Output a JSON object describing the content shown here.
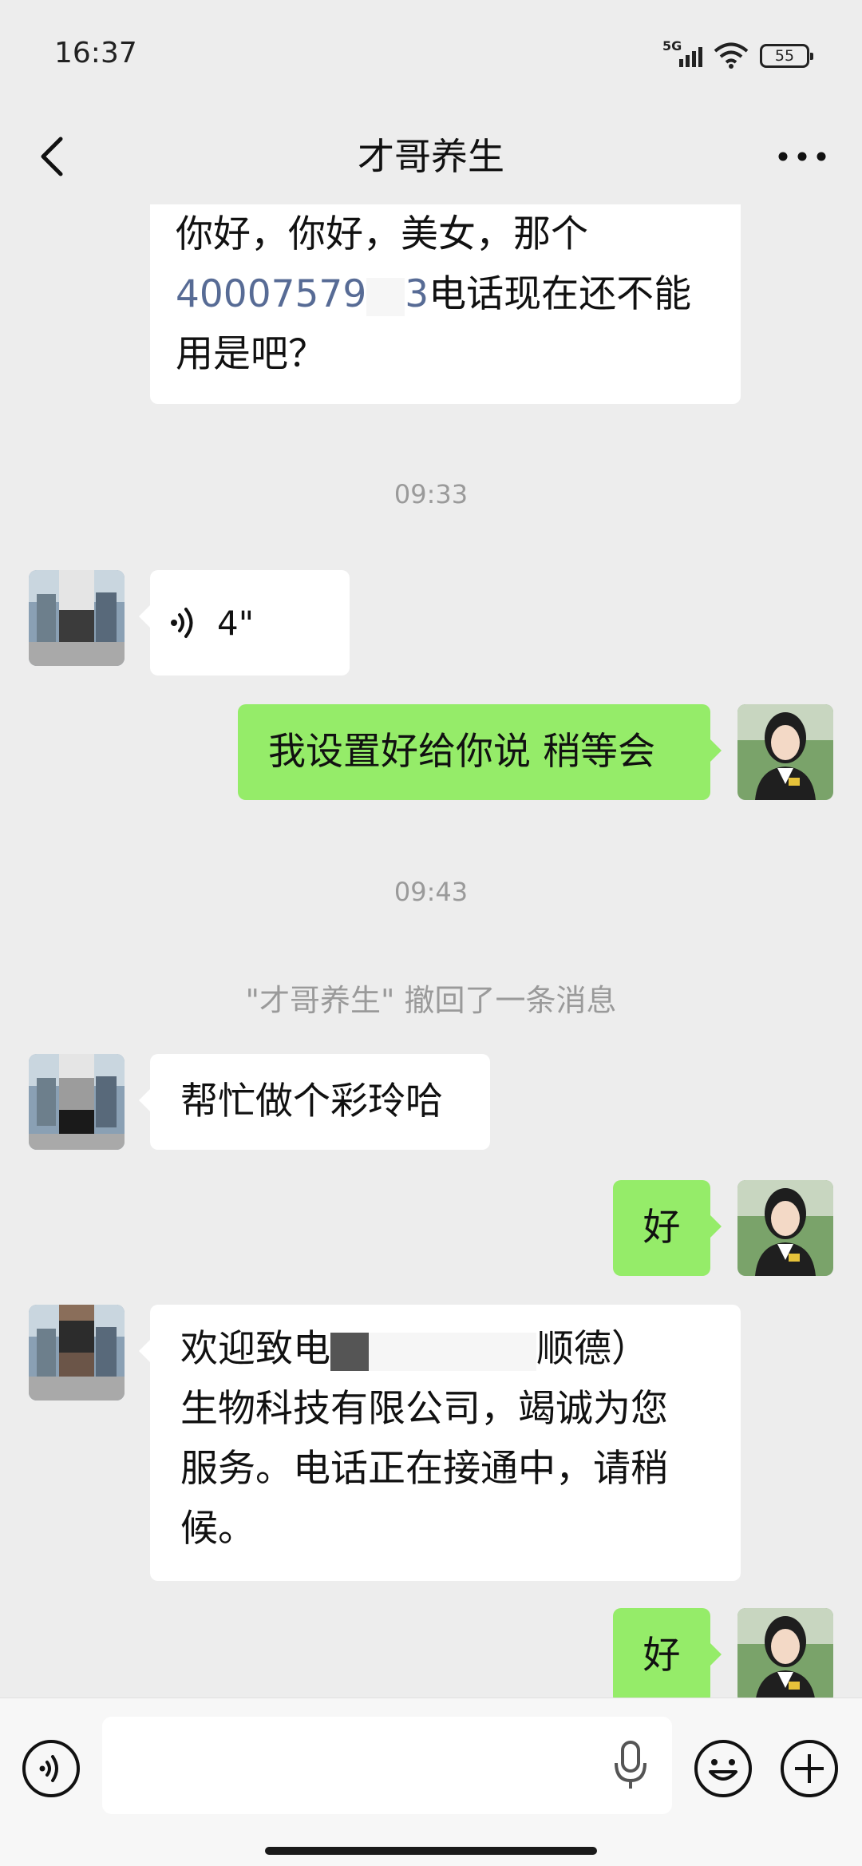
{
  "status_bar": {
    "time": "16:37",
    "network": "5G",
    "battery": "55"
  },
  "nav": {
    "title": "才哥养生"
  },
  "messages": {
    "m1": {
      "line1": "你好，你好，美女，那个",
      "phone": "40007579",
      "phone_tail": "3",
      "after_phone": "电话现在还不能",
      "line3": "用是吧？"
    },
    "ts1": "09:33",
    "voice1": {
      "duration": "4\""
    },
    "m3": "我设置好给你说 稍等会",
    "ts2": "09:43",
    "recall": "\"才哥养生\" 撤回了一条消息",
    "m4": "帮忙做个彩玲哈",
    "m5": "好",
    "m6": {
      "line1_a": "欢迎致电",
      "line1_b": "顺德）",
      "line2": "生物科技有限公司，竭诚为您",
      "line3": "服务。电话正在接通中，请稍",
      "line4": "候。"
    },
    "m7": "好"
  },
  "icons": {
    "back": "chevron-left-icon",
    "more": "more-dots-icon",
    "voice": "voice-input-icon",
    "mic": "microphone-icon",
    "emoji": "emoji-icon",
    "plus": "plus-icon"
  }
}
